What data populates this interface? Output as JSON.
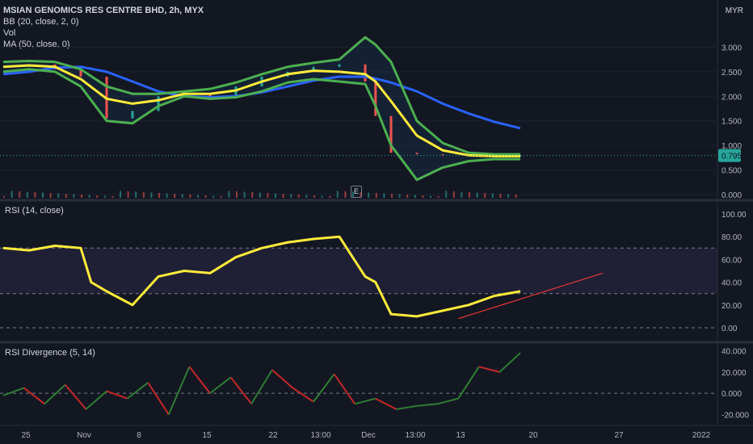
{
  "header": {
    "symbol_title": "MSIAN GENOMICS RES CENTRE BHD, 2h, MYX",
    "indicators": [
      "BB (20, close, 2, 0)",
      "Vol",
      "MA (50, close, 0)"
    ],
    "currency": "MYR",
    "earnings_marker": "E"
  },
  "colors": {
    "background": "#131722",
    "bb_band": "#4caf50",
    "bb_basis": "#ffeb3b",
    "ma": "#2962ff",
    "rsi": "#ffeb3b",
    "rsi_zone": "#7e57c2",
    "div_up": "#2e7d32",
    "div_down": "#c62828",
    "trendline": "#e53935",
    "price_label": "#26a69a",
    "candle_up": "#26a69a",
    "candle_down": "#ef5350"
  },
  "xaxis": {
    "labels": [
      "25",
      "Nov",
      "8",
      "15",
      "22",
      "13:00",
      "Dec",
      "13:00",
      "13",
      "20",
      "27",
      "2022"
    ]
  },
  "chart_data": [
    {
      "type": "line",
      "panel": "price",
      "yticks": [
        "3.000",
        "2.500",
        "2.000",
        "1.500",
        "1.000",
        "0.500",
        "0.000"
      ],
      "ylim": [
        0,
        3.5
      ],
      "current_price": "0.795",
      "x": [
        0,
        5,
        10,
        15,
        20,
        25,
        30,
        35,
        40,
        45,
        50,
        55,
        60,
        65,
        70,
        72,
        75,
        80,
        85,
        90,
        95,
        100
      ],
      "series": [
        {
          "name": "BB basis",
          "values": [
            2.6,
            2.63,
            2.6,
            2.35,
            1.95,
            1.85,
            1.92,
            2.05,
            2.05,
            2.12,
            2.3,
            2.45,
            2.52,
            2.5,
            2.45,
            2.3,
            1.9,
            1.2,
            0.9,
            0.8,
            0.78,
            0.78
          ]
        },
        {
          "name": "BB upper",
          "values": [
            2.7,
            2.72,
            2.7,
            2.55,
            2.2,
            2.05,
            2.05,
            2.1,
            2.15,
            2.28,
            2.45,
            2.6,
            2.68,
            2.75,
            3.2,
            3.05,
            2.7,
            1.5,
            1.05,
            0.85,
            0.82,
            0.82
          ]
        },
        {
          "name": "BB lower",
          "values": [
            2.5,
            2.55,
            2.5,
            2.2,
            1.5,
            1.45,
            1.8,
            2.0,
            1.95,
            1.98,
            2.1,
            2.28,
            2.35,
            2.3,
            2.25,
            1.8,
            1.0,
            0.3,
            0.55,
            0.68,
            0.72,
            0.72
          ]
        },
        {
          "name": "MA 50",
          "values": [
            2.45,
            2.5,
            2.58,
            2.6,
            2.5,
            2.3,
            2.1,
            2.0,
            1.98,
            2.0,
            2.08,
            2.2,
            2.32,
            2.4,
            2.4,
            2.36,
            2.28,
            2.1,
            1.85,
            1.65,
            1.48,
            1.35
          ]
        },
        {
          "name": "Close",
          "values": [
            2.6,
            2.65,
            2.55,
            2.4,
            1.55,
            1.7,
            2.0,
            2.05,
            1.98,
            2.2,
            2.4,
            2.5,
            2.6,
            2.65,
            2.3,
            1.6,
            0.85,
            0.82,
            0.8,
            0.8,
            0.79,
            0.795
          ]
        }
      ]
    },
    {
      "type": "line",
      "panel": "rsi",
      "title": "RSI (14, close)",
      "yticks": [
        "100.00",
        "80.00",
        "60.00",
        "40.00",
        "20.00",
        "0.00"
      ],
      "ylim": [
        0,
        100
      ],
      "upper_band": 70,
      "lower_band": 30,
      "x": [
        0,
        5,
        10,
        15,
        17,
        20,
        25,
        30,
        35,
        40,
        45,
        50,
        55,
        60,
        65,
        70,
        72,
        75,
        80,
        85,
        90,
        95,
        100
      ],
      "values": [
        70,
        68,
        72,
        70,
        40,
        32,
        20,
        45,
        50,
        48,
        62,
        70,
        75,
        78,
        80,
        45,
        40,
        12,
        10,
        15,
        20,
        28,
        32
      ],
      "trendline": {
        "from": [
          88,
          8
        ],
        "to": [
          116,
          48
        ]
      }
    },
    {
      "type": "line",
      "panel": "rsi_divergence",
      "title": "RSI Divergence (5, 14)",
      "yticks": [
        "40.000",
        "20.000",
        "0.000",
        "-20.000"
      ],
      "ylim": [
        -25,
        45
      ],
      "x": [
        0,
        4,
        8,
        12,
        16,
        20,
        24,
        28,
        32,
        36,
        40,
        44,
        48,
        52,
        56,
        60,
        64,
        68,
        72,
        76,
        80,
        84,
        88,
        92,
        96,
        100
      ],
      "values": [
        -2,
        5,
        -10,
        8,
        -15,
        2,
        -5,
        10,
        -20,
        25,
        0,
        15,
        -10,
        22,
        5,
        -8,
        18,
        -10,
        -5,
        -15,
        -12,
        -10,
        -5,
        25,
        20,
        38
      ]
    }
  ]
}
